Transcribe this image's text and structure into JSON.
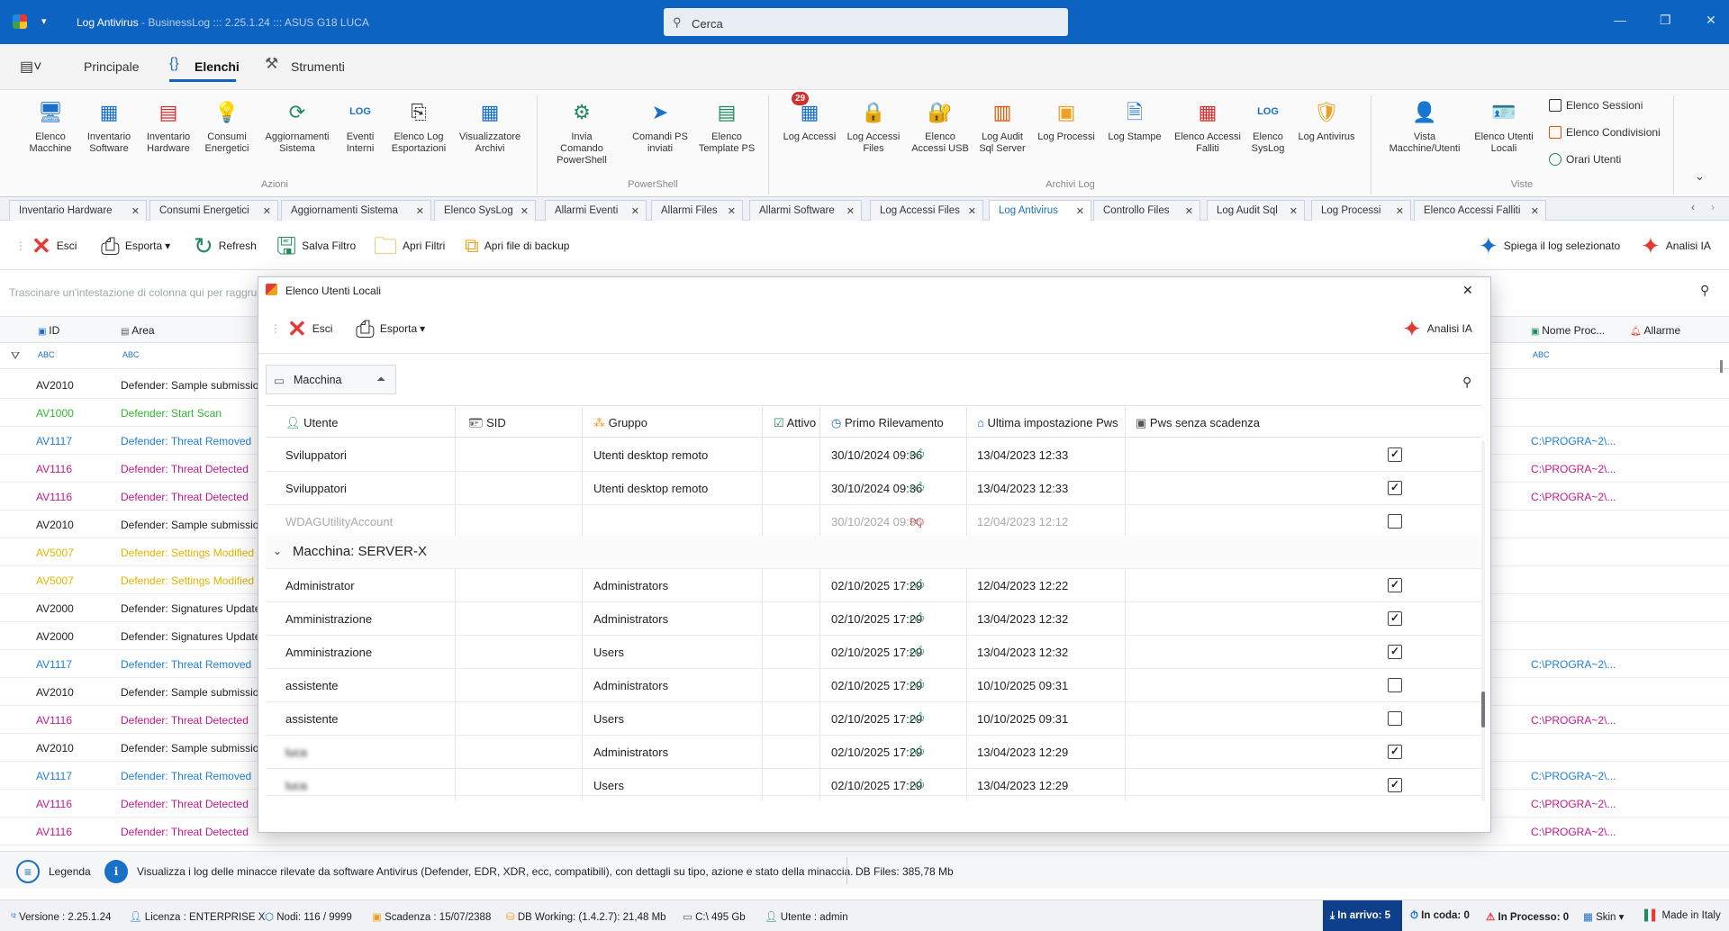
{
  "window": {
    "title": "Log Antivirus",
    "subtitle": " - BusinessLog ::: 2.25.1.24 ::: ASUS G18 LUCA",
    "search_placeholder": "Cerca"
  },
  "ribbon_tabs": [
    "Principale",
    "Elenchi",
    "Strumenti"
  ],
  "ribbon": {
    "azioni": {
      "label": "Azioni",
      "items": [
        "Elenco\nMacchine",
        "Inventario\nSoftware",
        "Inventario\nHardware",
        "Consumi\nEnergetici",
        "Aggiornamenti\nSistema",
        "Eventi\nInterni",
        "Elenco Log\nEsportazioni",
        "Visualizzatore\nArchivi"
      ]
    },
    "powershell": {
      "label": "PowerShell",
      "items": [
        "Invia Comando\nPowerShell",
        "Comandi PS\ninviati",
        "Elenco\nTemplate PS"
      ]
    },
    "archivi": {
      "label": "Archivi Log",
      "badge": "29",
      "items": [
        "Log Accessi",
        "Log Accessi\nFiles",
        "Elenco\nAccessi USB",
        "Log Audit\nSql Server",
        "Log Processi",
        "Log Stampe",
        "Elenco Accessi\nFalliti",
        "Elenco\nSysLog",
        "Log Antivirus"
      ]
    },
    "viste": {
      "label": "Viste",
      "items": [
        "Vista\nMacchine/Utenti",
        "Elenco Utenti\nLocali"
      ],
      "side_items": [
        "Elenco Sessioni",
        "Elenco Condivisioni",
        "Orari Utenti"
      ]
    }
  },
  "doc_tabs": [
    "Inventario Hardware",
    "Consumi Energetici",
    "Aggiornamenti Sistema",
    "Elenco SysLog",
    "Allarmi Eventi",
    "Allarmi Files",
    "Allarmi Software",
    "Log Accessi Files",
    "Log Antivirus",
    "Controllo Files",
    "Log Audit Sql",
    "Log Processi",
    "Elenco Accessi Falliti"
  ],
  "toolbar": {
    "esci": "Esci",
    "esporta": "Esporta",
    "refresh": "Refresh",
    "salva_filtro": "Salva Filtro",
    "apri_filtri": "Apri Filtri",
    "apri_backup": "Apri file di backup",
    "spiega": "Spiega il log selezionato",
    "analisi": "Analisi IA"
  },
  "grid": {
    "group_hint": "Trascinare un'intestazione di colonna qui per raggru",
    "columns": {
      "id": "ID",
      "area": "Area",
      "nome_proc": "Nome Proc...",
      "allarme": "Allarme"
    },
    "rows": [
      {
        "id": "AV2010",
        "area": "Defender: Sample submissio",
        "color": "dark",
        "path": ""
      },
      {
        "id": "AV1000",
        "area": "Defender: Start Scan",
        "color": "green",
        "path": ""
      },
      {
        "id": "AV1117",
        "area": "Defender: Threat Removed",
        "color": "blue",
        "path": "C:\\PROGRA~2\\..."
      },
      {
        "id": "AV1116",
        "area": "Defender: Threat Detected",
        "color": "mag",
        "path": "C:\\PROGRA~2\\..."
      },
      {
        "id": "AV1116",
        "area": "Defender: Threat Detected",
        "color": "mag",
        "path": "C:\\PROGRA~2\\..."
      },
      {
        "id": "AV2010",
        "area": "Defender: Sample submissio",
        "color": "dark",
        "path": ""
      },
      {
        "id": "AV5007",
        "area": "Defender: Settings Modified",
        "color": "yel",
        "path": ""
      },
      {
        "id": "AV5007",
        "area": "Defender: Settings Modified",
        "color": "yel",
        "path": ""
      },
      {
        "id": "AV2000",
        "area": "Defender: Signatures Update",
        "color": "dark",
        "path": ""
      },
      {
        "id": "AV2000",
        "area": "Defender: Signatures Update",
        "color": "dark",
        "path": ""
      },
      {
        "id": "AV1117",
        "area": "Defender: Threat Removed",
        "color": "blue",
        "path": "C:\\PROGRA~2\\..."
      },
      {
        "id": "AV2010",
        "area": "Defender: Sample submissio",
        "color": "dark",
        "path": ""
      },
      {
        "id": "AV1116",
        "area": "Defender: Threat Detected",
        "color": "mag",
        "path": "C:\\PROGRA~2\\..."
      },
      {
        "id": "AV2010",
        "area": "Defender: Sample submissio",
        "color": "dark",
        "path": ""
      },
      {
        "id": "AV1117",
        "area": "Defender: Threat Removed",
        "color": "blue",
        "path": "C:\\PROGRA~2\\..."
      },
      {
        "id": "AV1116",
        "area": "Defender: Threat Detected",
        "color": "mag",
        "path": "C:\\PROGRA~2\\..."
      },
      {
        "id": "AV1116",
        "area": "Defender: Threat Detected",
        "color": "mag",
        "path": "C:\\PROGRA~2\\..."
      }
    ]
  },
  "modal": {
    "title": "Elenco Utenti Locali",
    "esci": "Esci",
    "esporta": "Esporta",
    "analisi": "Analisi IA",
    "group_field": "Macchina",
    "columns": {
      "utente": "Utente",
      "sid": "SID",
      "gruppo": "Gruppo",
      "attivo": "Attivo",
      "primo": "Primo Rilevamento",
      "ultima": "Ultima impostazione Pws",
      "pws": "Pws senza scadenza"
    },
    "group2_label": "Macchina: SERVER-X",
    "rows_top": [
      {
        "utente": "Sviluppatori",
        "gruppo": "Utenti desktop remoto",
        "attivo": true,
        "primo": "30/10/2024 09:36",
        "ultima": "13/04/2023 12:33",
        "pws": true,
        "dim": false
      },
      {
        "utente": "Sviluppatori",
        "gruppo": "Utenti desktop remoto",
        "attivo": true,
        "primo": "30/10/2024 09:36",
        "ultima": "13/04/2023 12:33",
        "pws": true,
        "dim": false
      },
      {
        "utente": "WDAGUtilityAccount",
        "gruppo": "",
        "attivo": false,
        "primo": "30/10/2024 09:36",
        "ultima": "12/04/2023 12:12",
        "pws": false,
        "dim": true
      }
    ],
    "rows_bottom": [
      {
        "utente": "Administrator",
        "gruppo": "Administrators",
        "attivo": true,
        "primo": "02/10/2025 17:29",
        "ultima": "12/04/2023 12:22",
        "pws": true
      },
      {
        "utente": "Amministrazione",
        "gruppo": "Administrators",
        "attivo": true,
        "primo": "02/10/2025 17:29",
        "ultima": "13/04/2023 12:32",
        "pws": true
      },
      {
        "utente": "Amministrazione",
        "gruppo": "Users",
        "attivo": true,
        "primo": "02/10/2025 17:29",
        "ultima": "13/04/2023 12:32",
        "pws": true
      },
      {
        "utente": "assistente",
        "gruppo": "Administrators",
        "attivo": true,
        "primo": "02/10/2025 17:29",
        "ultima": "10/10/2025 09:31",
        "pws": false
      },
      {
        "utente": "assistente",
        "gruppo": "Users",
        "attivo": true,
        "primo": "02/10/2025 17:29",
        "ultima": "10/10/2025 09:31",
        "pws": false
      },
      {
        "utente": "luca",
        "gruppo": "Administrators",
        "attivo": true,
        "primo": "02/10/2025 17:29",
        "ultima": "13/04/2023 12:29",
        "pws": true,
        "blur": true
      },
      {
        "utente": "luca",
        "gruppo": "Users",
        "attivo": true,
        "primo": "02/10/2025 17:29",
        "ultima": "13/04/2023 12:29",
        "pws": true,
        "blur": true
      }
    ]
  },
  "infobar": {
    "legenda": "Legenda",
    "description": "Visualizza i log delle minacce rilevate da software Antivirus (Defender, EDR, XDR, ecc, compatibili), con dettagli su tipo, azione e stato della minaccia.",
    "db_files": "DB Files: 385,78 Mb"
  },
  "statusbar": {
    "versione": "Versione : 2.25.1.24",
    "licenza": "Licenza : ENTERPRISE X",
    "nodi": "Nodi: 116 / 9999",
    "scadenza": "Scadenza : 15/07/2388",
    "db_working": "DB Working: (1.4.2.7): 21,48 Mb",
    "disk": "C:\\ 495 Gb",
    "utente": "Utente : admin",
    "in_arrivo": "In arrivo: 5",
    "in_coda": "In coda: 0",
    "in_processo": "In Processo: 0",
    "skin": "Skin",
    "made_in": "Made in Italy"
  },
  "colors": {
    "accent": "#0d63c1",
    "thumb_up": "#1f8a5b",
    "thumb_down": "#d32f2f"
  }
}
